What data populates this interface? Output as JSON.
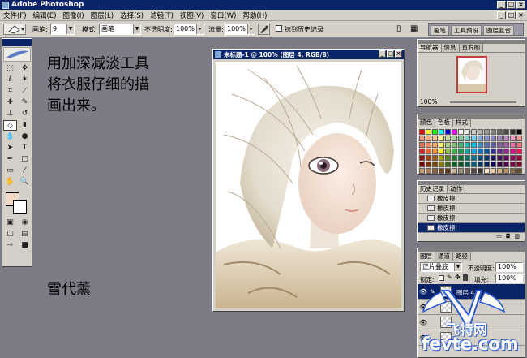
{
  "window": {
    "title": "Adobe Photoshop",
    "min": "_",
    "max": "□",
    "close": "×"
  },
  "menu": [
    "文件(F)",
    "编辑(E)",
    "图像(I)",
    "图层(L)",
    "选择(S)",
    "滤镜(T)",
    "视图(V)",
    "窗口(W)",
    "帮助(H)"
  ],
  "options": {
    "brush_label": "画笔:",
    "brush_size": "9",
    "mode_label": "模式:",
    "mode_value": "画笔",
    "opacity_label": "不透明度:",
    "opacity_value": "100%",
    "flow_label": "流量:",
    "flow_value": "100%",
    "history_label": "抹到历史记录",
    "well_tabs": [
      "画笔",
      "工具预设",
      "图层复合"
    ]
  },
  "annotations": {
    "line1": "用加深减淡工具",
    "line2": "将衣服仔细的描",
    "line3": "画出来。",
    "signature": "雪代薰"
  },
  "document": {
    "title": "未标题-1 @ 100% (图层 4, RGB/8)"
  },
  "navigator": {
    "tabs": [
      "导航器",
      "信息",
      "直方图"
    ],
    "zoom": "100%"
  },
  "color_palette": {
    "tabs": [
      "颜色",
      "色板",
      "样式"
    ],
    "swatch_colors": [
      "#ff0000",
      "#ffff00",
      "#00ff00",
      "#00ffff",
      "#0000ff",
      "#ff00ff",
      "#ffffff",
      "#e6e6e6",
      "#cccccc",
      "#b3b3b3",
      "#999999",
      "#808080",
      "#666666",
      "#4d4d4d",
      "#333333",
      "#000000",
      "#f7977a",
      "#fbad82",
      "#fdc68c",
      "#fff799",
      "#c6df9c",
      "#a4d49d",
      "#81ca9d",
      "#7bcdc8",
      "#6ecff6",
      "#7ea7d8",
      "#8493ca",
      "#8882be",
      "#a286bd",
      "#bc8cbf",
      "#f49bc1",
      "#f5999d",
      "#f26c4f",
      "#f68e56",
      "#fbaf5a",
      "#fff467",
      "#acd372",
      "#7dc473",
      "#3cb878",
      "#1cbbb4",
      "#00bff3",
      "#448ccb",
      "#5574b9",
      "#605ca9",
      "#8560a8",
      "#a763a9",
      "#f06eaa",
      "#f26d7d",
      "#ed1c24",
      "#f26522",
      "#f7941d",
      "#fff200",
      "#8dc63f",
      "#39b54a",
      "#00a651",
      "#00a99d",
      "#00aeef",
      "#0072bc",
      "#0054a5",
      "#2e3192",
      "#662d91",
      "#92278f",
      "#ec008c",
      "#ed145b",
      "#9e0b0f",
      "#a0410d",
      "#a36209",
      "#aba000",
      "#598527",
      "#1a7b30",
      "#007236",
      "#00746b",
      "#0076a3",
      "#004b80",
      "#003471",
      "#1b1464",
      "#440e62",
      "#630460",
      "#9e005d",
      "#9e0039",
      "#790000",
      "#7b2e00",
      "#7d4900",
      "#827b00",
      "#406618",
      "#005e20",
      "#005826",
      "#005952",
      "#005b7f",
      "#003663",
      "#002157",
      "#0d004c",
      "#32004b",
      "#4b0049",
      "#7b0046",
      "#7a0026",
      "#c69c6d",
      "#a67c52",
      "#8c6239",
      "#754c24",
      "#603813",
      "#c7b299",
      "#998675",
      "#736357",
      "#534741",
      "#362f2d",
      "#fae6c8",
      "#ebcfa2",
      "#d2b17f",
      "#b48e5c",
      "#8d6e49",
      "#6b4f31"
    ]
  },
  "history": {
    "tabs": [
      "历史记录",
      "动作"
    ],
    "items": [
      "橡皮擦",
      "橡皮擦",
      "橡皮擦",
      "橡皮擦"
    ]
  },
  "layers": {
    "tabs": [
      "图层",
      "通道",
      "路径"
    ],
    "blend_mode": "正片叠底",
    "opacity_label": "不透明度:",
    "opacity_value": "100%",
    "lock_label": "锁定:",
    "fill_label": "填充:",
    "fill_value": "100%",
    "selected_layer": "图层 4"
  },
  "watermark": {
    "brand": "飞特网",
    "url": "fevte.com"
  }
}
